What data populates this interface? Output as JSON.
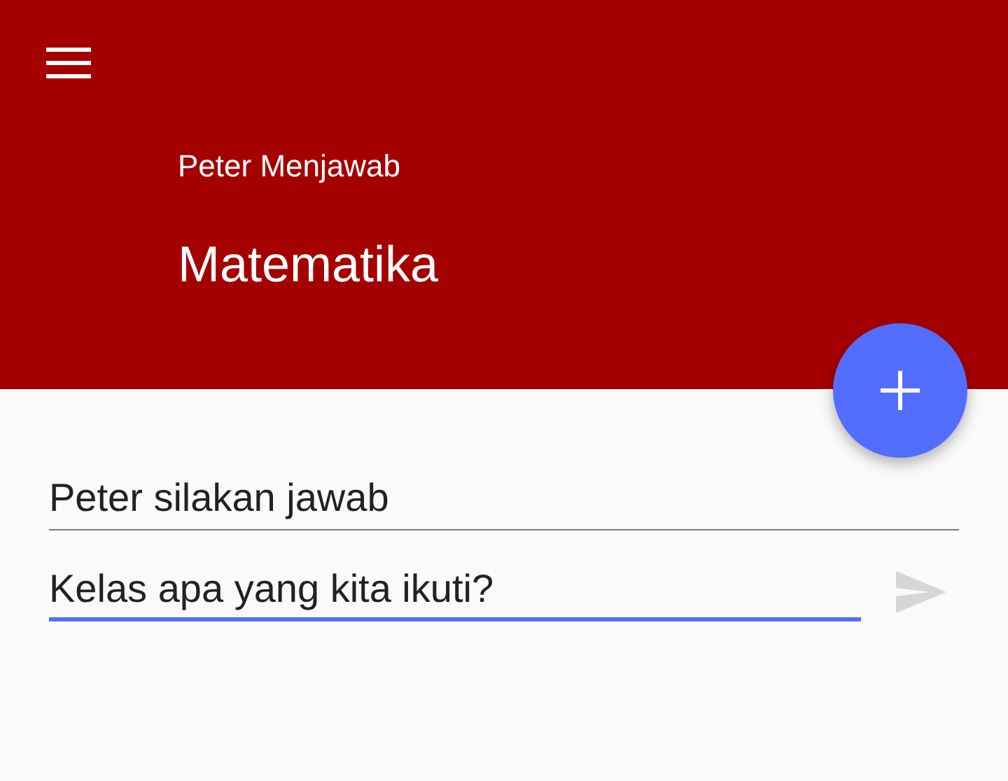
{
  "header": {
    "subtitle": "Peter Menjawab",
    "title": "Matematika"
  },
  "fields": [
    {
      "value": "Peter silakan jawab",
      "focused": false
    },
    {
      "value": "Kelas apa yang kita ikuti?",
      "focused": true
    }
  ],
  "send_button": {
    "disabled": true
  }
}
